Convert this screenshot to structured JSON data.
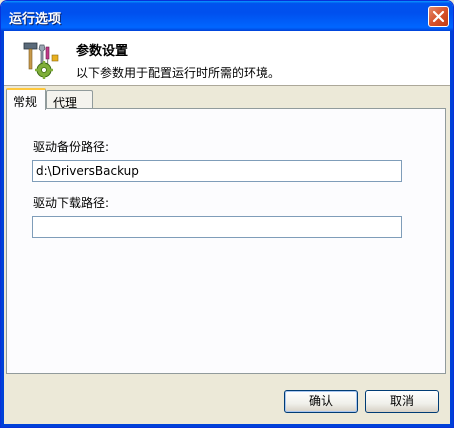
{
  "window": {
    "title": "运行选项"
  },
  "header": {
    "title": "参数设置",
    "subtitle": "以下参数用于配置运行时所需的环境。",
    "icon": "tools-gear-icon"
  },
  "tabs": [
    {
      "label": "常规",
      "active": true
    },
    {
      "label": "代理",
      "active": false
    }
  ],
  "general": {
    "backup_path_label": "驱动备份路径:",
    "backup_path_value": "d:\\DriversBackup",
    "download_path_label": "驱动下载路径:",
    "download_path_value": ""
  },
  "buttons": {
    "ok_label": "确认",
    "cancel_label": "取消"
  },
  "colors": {
    "titlebar": "#0054e3",
    "close_button": "#d6532d",
    "active_tab_accent": "#ffc83c",
    "dialog_background": "#ece9d8"
  }
}
